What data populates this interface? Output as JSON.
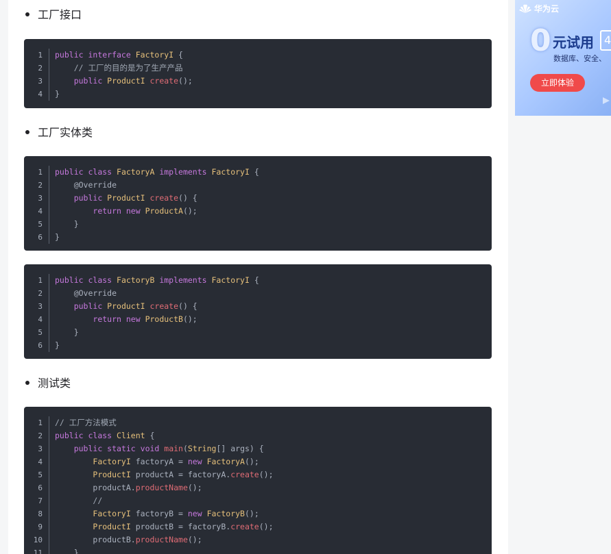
{
  "headings": {
    "factory_interface": "工厂接口",
    "factory_entity": "工厂实体类",
    "test_class": "测试类"
  },
  "code_blocks": {
    "factory_interface": [
      [
        [
          "keyword",
          "public "
        ],
        [
          "keyword",
          "interface "
        ],
        [
          "type",
          "FactoryI"
        ],
        [
          "plain",
          " {"
        ]
      ],
      [
        [
          "plain",
          "    "
        ],
        [
          "comment",
          "// 工厂的目的是为了生产产品"
        ]
      ],
      [
        [
          "plain",
          "    "
        ],
        [
          "keyword",
          "public "
        ],
        [
          "type",
          "ProductI "
        ],
        [
          "func",
          "create"
        ],
        [
          "plain",
          "();"
        ]
      ],
      [
        [
          "plain",
          "}"
        ]
      ]
    ],
    "factory_a": [
      [
        [
          "keyword",
          "public "
        ],
        [
          "keyword",
          "class "
        ],
        [
          "type",
          "FactoryA "
        ],
        [
          "keyword",
          "implements "
        ],
        [
          "type",
          "FactoryI"
        ],
        [
          "plain",
          " {"
        ]
      ],
      [
        [
          "plain",
          "    @Override"
        ]
      ],
      [
        [
          "plain",
          "    "
        ],
        [
          "keyword",
          "public "
        ],
        [
          "type",
          "ProductI "
        ],
        [
          "func",
          "create"
        ],
        [
          "plain",
          "() {"
        ]
      ],
      [
        [
          "plain",
          "        "
        ],
        [
          "keyword",
          "return "
        ],
        [
          "keyword",
          "new "
        ],
        [
          "type",
          "ProductA"
        ],
        [
          "plain",
          "();"
        ]
      ],
      [
        [
          "plain",
          "    }"
        ]
      ],
      [
        [
          "plain",
          "}"
        ]
      ]
    ],
    "factory_b": [
      [
        [
          "keyword",
          "public "
        ],
        [
          "keyword",
          "class "
        ],
        [
          "type",
          "FactoryB "
        ],
        [
          "keyword",
          "implements "
        ],
        [
          "type",
          "FactoryI"
        ],
        [
          "plain",
          " {"
        ]
      ],
      [
        [
          "plain",
          "    @Override"
        ]
      ],
      [
        [
          "plain",
          "    "
        ],
        [
          "keyword",
          "public "
        ],
        [
          "type",
          "ProductI "
        ],
        [
          "func",
          "create"
        ],
        [
          "plain",
          "() {"
        ]
      ],
      [
        [
          "plain",
          "        "
        ],
        [
          "keyword",
          "return "
        ],
        [
          "keyword",
          "new "
        ],
        [
          "type",
          "ProductB"
        ],
        [
          "plain",
          "();"
        ]
      ],
      [
        [
          "plain",
          "    }"
        ]
      ],
      [
        [
          "plain",
          "}"
        ]
      ]
    ],
    "client": [
      [
        [
          "comment",
          "// 工厂方法模式"
        ]
      ],
      [
        [
          "keyword",
          "public "
        ],
        [
          "keyword",
          "class "
        ],
        [
          "type",
          "Client"
        ],
        [
          "plain",
          " {"
        ]
      ],
      [
        [
          "plain",
          "    "
        ],
        [
          "keyword",
          "public "
        ],
        [
          "keyword",
          "static "
        ],
        [
          "keyword",
          "void "
        ],
        [
          "func",
          "main"
        ],
        [
          "plain",
          "("
        ],
        [
          "type",
          "String"
        ],
        [
          "plain",
          "[] args) {"
        ]
      ],
      [
        [
          "plain",
          "        "
        ],
        [
          "type",
          "FactoryI"
        ],
        [
          "plain",
          " factoryA = "
        ],
        [
          "keyword",
          "new "
        ],
        [
          "type",
          "FactoryA"
        ],
        [
          "plain",
          "();"
        ]
      ],
      [
        [
          "plain",
          "        "
        ],
        [
          "type",
          "ProductI"
        ],
        [
          "plain",
          " productA = factoryA."
        ],
        [
          "func",
          "create"
        ],
        [
          "plain",
          "();"
        ]
      ],
      [
        [
          "plain",
          "        productA."
        ],
        [
          "func",
          "productName"
        ],
        [
          "plain",
          "();"
        ]
      ],
      [
        [
          "plain",
          "        "
        ],
        [
          "comment",
          "//"
        ]
      ],
      [
        [
          "plain",
          "        "
        ],
        [
          "type",
          "FactoryI"
        ],
        [
          "plain",
          " factoryB = "
        ],
        [
          "keyword",
          "new "
        ],
        [
          "type",
          "FactoryB"
        ],
        [
          "plain",
          "();"
        ]
      ],
      [
        [
          "plain",
          "        "
        ],
        [
          "type",
          "ProductI"
        ],
        [
          "plain",
          " productB = factoryB."
        ],
        [
          "func",
          "create"
        ],
        [
          "plain",
          "();"
        ]
      ],
      [
        [
          "plain",
          "        productB."
        ],
        [
          "func",
          "productName"
        ],
        [
          "plain",
          "();"
        ]
      ],
      [
        [
          "plain",
          "    }"
        ]
      ]
    ]
  },
  "client_line_numbers": [
    "1",
    "2",
    "3",
    "4",
    "5",
    "6",
    "7",
    "8",
    "9",
    "10",
    "11"
  ],
  "ad": {
    "brand": "华为云",
    "zero": "0",
    "headline": "元试用",
    "box_text": "4",
    "subline": "数据库、安全、",
    "cta": "立即体验"
  }
}
